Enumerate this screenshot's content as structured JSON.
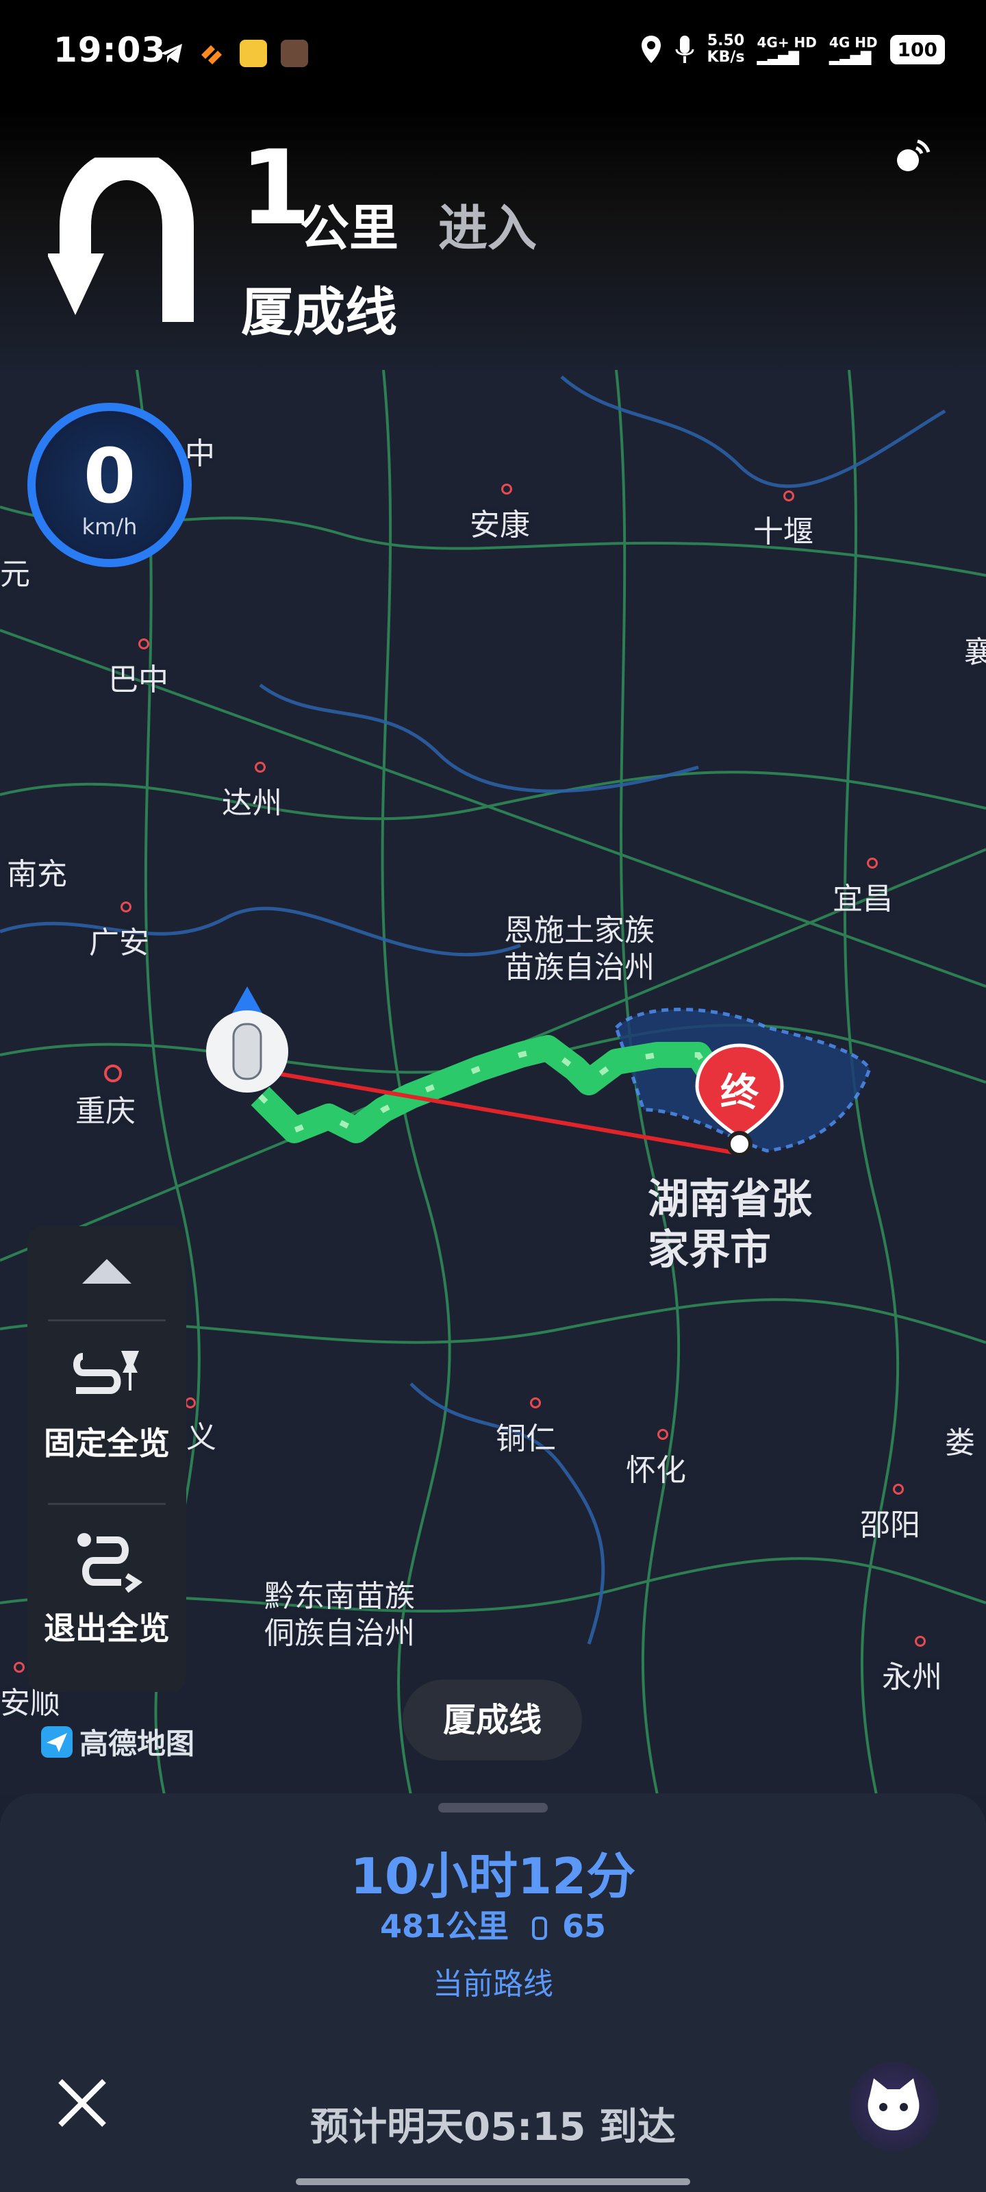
{
  "status_bar": {
    "time": "19:03",
    "speed_value": "5.50",
    "speed_unit": "KB/s",
    "net1": "4G+ HD",
    "net2": "4G HD",
    "battery": "100"
  },
  "nav": {
    "distance_number": "1",
    "distance_unit": "公里",
    "action": "进入",
    "road": "厦成线",
    "turn_icon": "u-turn-icon"
  },
  "speedometer": {
    "value": "0",
    "unit": "km/h"
  },
  "map": {
    "cities": [
      "中",
      "安康",
      "十堰",
      "元",
      "巴中",
      "襄",
      "达州",
      "南充",
      "广安",
      "宜昌",
      "恩施土家族",
      "苗族自治州",
      "重庆",
      "义",
      "铜仁",
      "怀化",
      "娄",
      "邵阳",
      "黔东南苗族",
      "侗族自治州",
      "永州",
      "安顺"
    ],
    "destination_label_1": "湖南省张",
    "destination_label_2": "家界市",
    "destination_marker": "终",
    "brand": "高德地图"
  },
  "side_panel": {
    "fix_overview": "固定全览",
    "exit_overview": "退出全览"
  },
  "current_road": "厦成线",
  "route": {
    "eta": "10小时12分",
    "distance": "481公里",
    "lights": "65",
    "label": "当前路线",
    "arrival": "预计明天05:15 到达"
  }
}
